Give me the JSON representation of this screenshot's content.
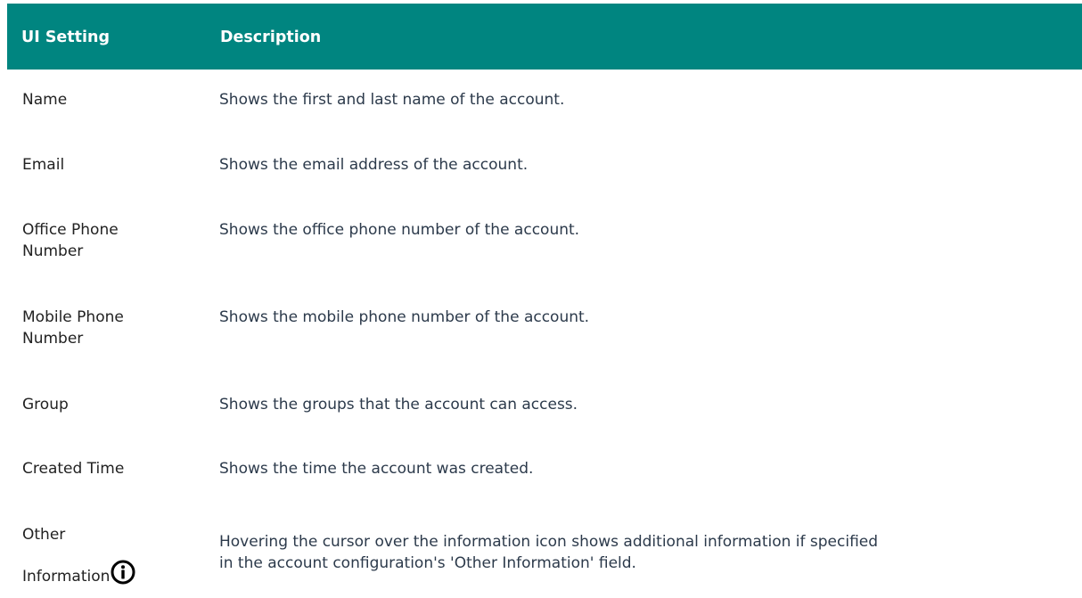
{
  "table": {
    "headers": {
      "setting": "UI Setting",
      "description": "Description"
    },
    "rows": [
      {
        "setting_lines": [
          "Name"
        ],
        "description": "Shows the first and last name of the account."
      },
      {
        "setting_lines": [
          "Email"
        ],
        "description": "Shows the email address of the account."
      },
      {
        "setting_lines": [
          "Office Phone",
          "Number"
        ],
        "description": "Shows the office phone number of the account."
      },
      {
        "setting_lines": [
          "Mobile Phone",
          "Number"
        ],
        "description": "Shows the mobile phone number of the account."
      },
      {
        "setting_lines": [
          "Group"
        ],
        "description": "Shows the groups that the account can access."
      },
      {
        "setting_lines": [
          "Created Time"
        ],
        "description": "Shows the time the account was created."
      },
      {
        "setting_lines": [
          "Other",
          "Information"
        ],
        "description_lines": [
          "Hovering the cursor over the information icon shows additional information if specified",
          "in the account configuration's 'Other Information' field."
        ],
        "icon": "info-circle-icon"
      }
    ]
  },
  "colors": {
    "header_bg": "#008580",
    "header_text": "#ffffff",
    "setting_text": "#222222",
    "description_text": "#2c3a4b"
  }
}
